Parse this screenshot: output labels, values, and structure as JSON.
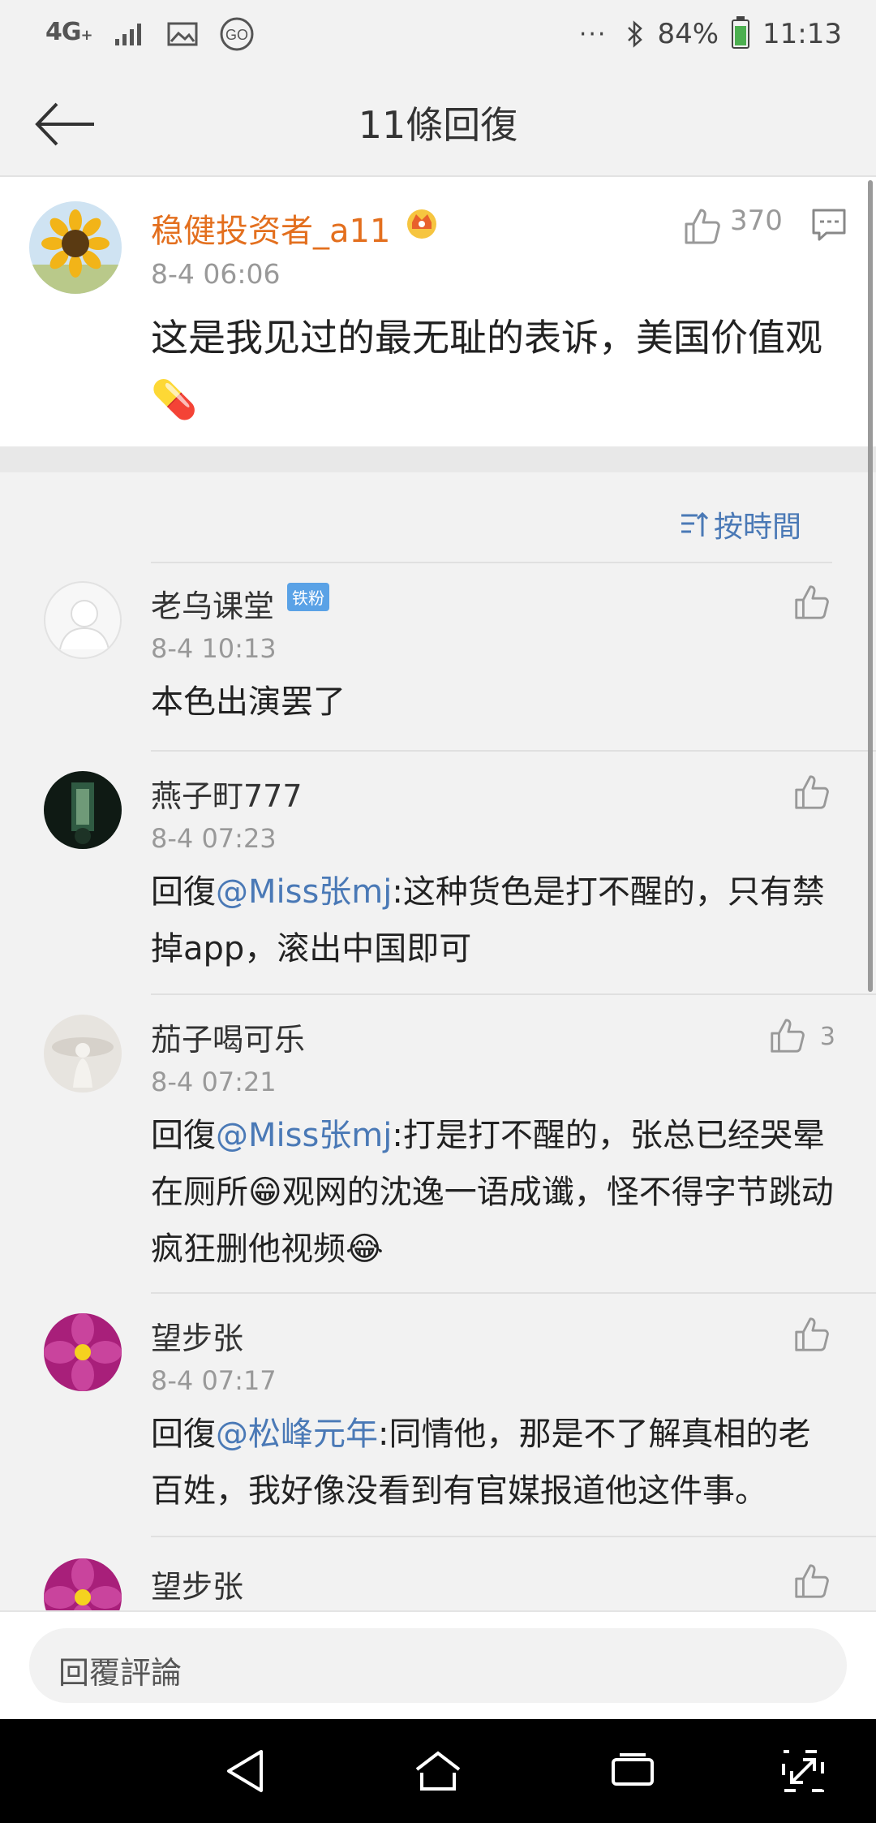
{
  "status_bar": {
    "network": "4G",
    "network_sub": "+",
    "more": "···",
    "battery": "84%",
    "time": "11:13"
  },
  "header": {
    "title": "11條回復"
  },
  "main_comment": {
    "user": "稳健投资者_a11",
    "time": "8-4 06:06",
    "text": "这是我见过的最无耻的表诉，美国价值观💊",
    "likes": "370"
  },
  "sort": {
    "label": "按時間"
  },
  "replies": [
    {
      "user": "老乌课堂",
      "badge": "铁粉",
      "time": "8-4 10:13",
      "text": "本色出演罢了",
      "likes": ""
    },
    {
      "user": "燕子町777",
      "time": "8-4 07:23",
      "prefix": "回復",
      "mention": "@Miss张mj",
      "text": ":这种货色是打不醒的，只有禁掉app，滚出中国即可",
      "likes": ""
    },
    {
      "user": "茄子喝可乐",
      "time": "8-4 07:21",
      "prefix": "回復",
      "mention": "@Miss张mj",
      "text": ":打是打不醒的，张总已经哭晕在厕所😁观网的沈逸一语成谶，怪不得字节跳动疯狂删他视频😂",
      "likes": "3"
    },
    {
      "user": "望步张",
      "time": "8-4 07:17",
      "prefix": "回復",
      "mention": "@松峰元年",
      "text": ":同情他，那是不了解真相的老百姓，我好像没看到有官媒报道他这件事。",
      "likes": ""
    },
    {
      "user": "望步张",
      "likes": ""
    }
  ],
  "input": {
    "placeholder": "回覆評論"
  },
  "colors": {
    "accent_blue": "#4a79b6",
    "username_orange": "#e36f1e"
  }
}
